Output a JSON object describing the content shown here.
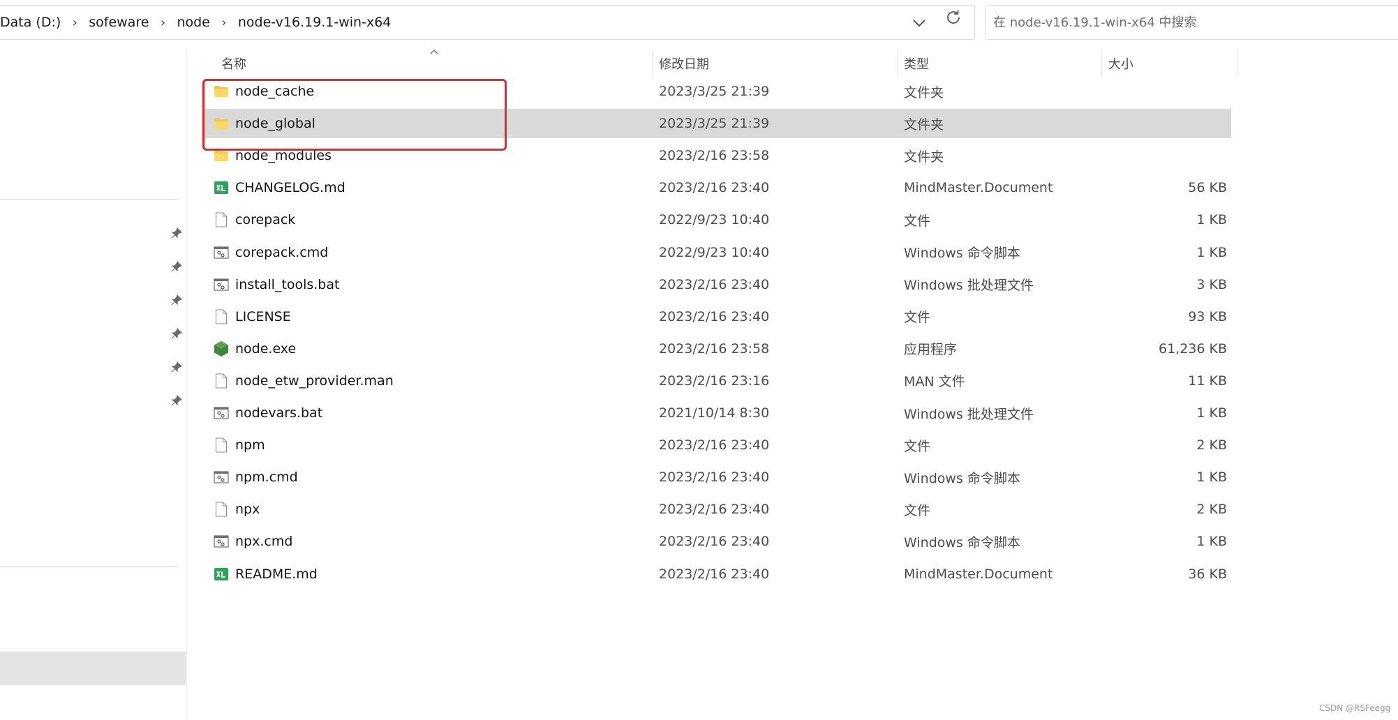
{
  "breadcrumb": [
    "Data (D:)",
    "sofeware",
    "node",
    "node-v16.19.1-win-x64"
  ],
  "search": {
    "placeholder": "在 node-v16.19.1-win-x64 中搜索"
  },
  "columns": {
    "name": "名称",
    "date": "修改日期",
    "type": "类型",
    "size": "大小"
  },
  "files": [
    {
      "icon": "folder-icon",
      "name": "node_cache",
      "date": "2023/3/25 21:39",
      "type": "文件夹",
      "size": ""
    },
    {
      "icon": "folder-icon",
      "name": "node_global",
      "date": "2023/3/25 21:39",
      "type": "文件夹",
      "size": "",
      "selected": true
    },
    {
      "icon": "folder-icon",
      "name": "node_modules",
      "date": "2023/2/16 23:58",
      "type": "文件夹",
      "size": ""
    },
    {
      "icon": "mindmaster-file-icon",
      "name": "CHANGELOG.md",
      "date": "2023/2/16 23:40",
      "type": "MindMaster.Document",
      "size": "56 KB"
    },
    {
      "icon": "blank-file-icon",
      "name": "corepack",
      "date": "2022/9/23 10:40",
      "type": "文件",
      "size": "1 KB"
    },
    {
      "icon": "script-file-icon",
      "name": "corepack.cmd",
      "date": "2022/9/23 10:40",
      "type": "Windows 命令脚本",
      "size": "1 KB"
    },
    {
      "icon": "script-file-icon",
      "name": "install_tools.bat",
      "date": "2023/2/16 23:40",
      "type": "Windows 批处理文件",
      "size": "3 KB"
    },
    {
      "icon": "blank-file-icon",
      "name": "LICENSE",
      "date": "2023/2/16 23:40",
      "type": "文件",
      "size": "93 KB"
    },
    {
      "icon": "node-exe-icon",
      "name": "node.exe",
      "date": "2023/2/16 23:58",
      "type": "应用程序",
      "size": "61,236 KB"
    },
    {
      "icon": "blank-file-icon",
      "name": "node_etw_provider.man",
      "date": "2023/2/16 23:16",
      "type": "MAN 文件",
      "size": "11 KB"
    },
    {
      "icon": "script-file-icon",
      "name": "nodevars.bat",
      "date": "2021/10/14 8:30",
      "type": "Windows 批处理文件",
      "size": "1 KB"
    },
    {
      "icon": "blank-file-icon",
      "name": "npm",
      "date": "2023/2/16 23:40",
      "type": "文件",
      "size": "2 KB"
    },
    {
      "icon": "script-file-icon",
      "name": "npm.cmd",
      "date": "2023/2/16 23:40",
      "type": "Windows 命令脚本",
      "size": "1 KB"
    },
    {
      "icon": "blank-file-icon",
      "name": "npx",
      "date": "2023/2/16 23:40",
      "type": "文件",
      "size": "2 KB"
    },
    {
      "icon": "script-file-icon",
      "name": "npx.cmd",
      "date": "2023/2/16 23:40",
      "type": "Windows 命令脚本",
      "size": "1 KB"
    },
    {
      "icon": "mindmaster-file-icon",
      "name": "README.md",
      "date": "2023/2/16 23:40",
      "type": "MindMaster.Document",
      "size": "36 KB"
    }
  ],
  "watermark": "CSDN @RSFeegg",
  "colors": {
    "highlight": "#e8262b",
    "selection": "#d9d9d9",
    "folder": "#f8c93e"
  }
}
